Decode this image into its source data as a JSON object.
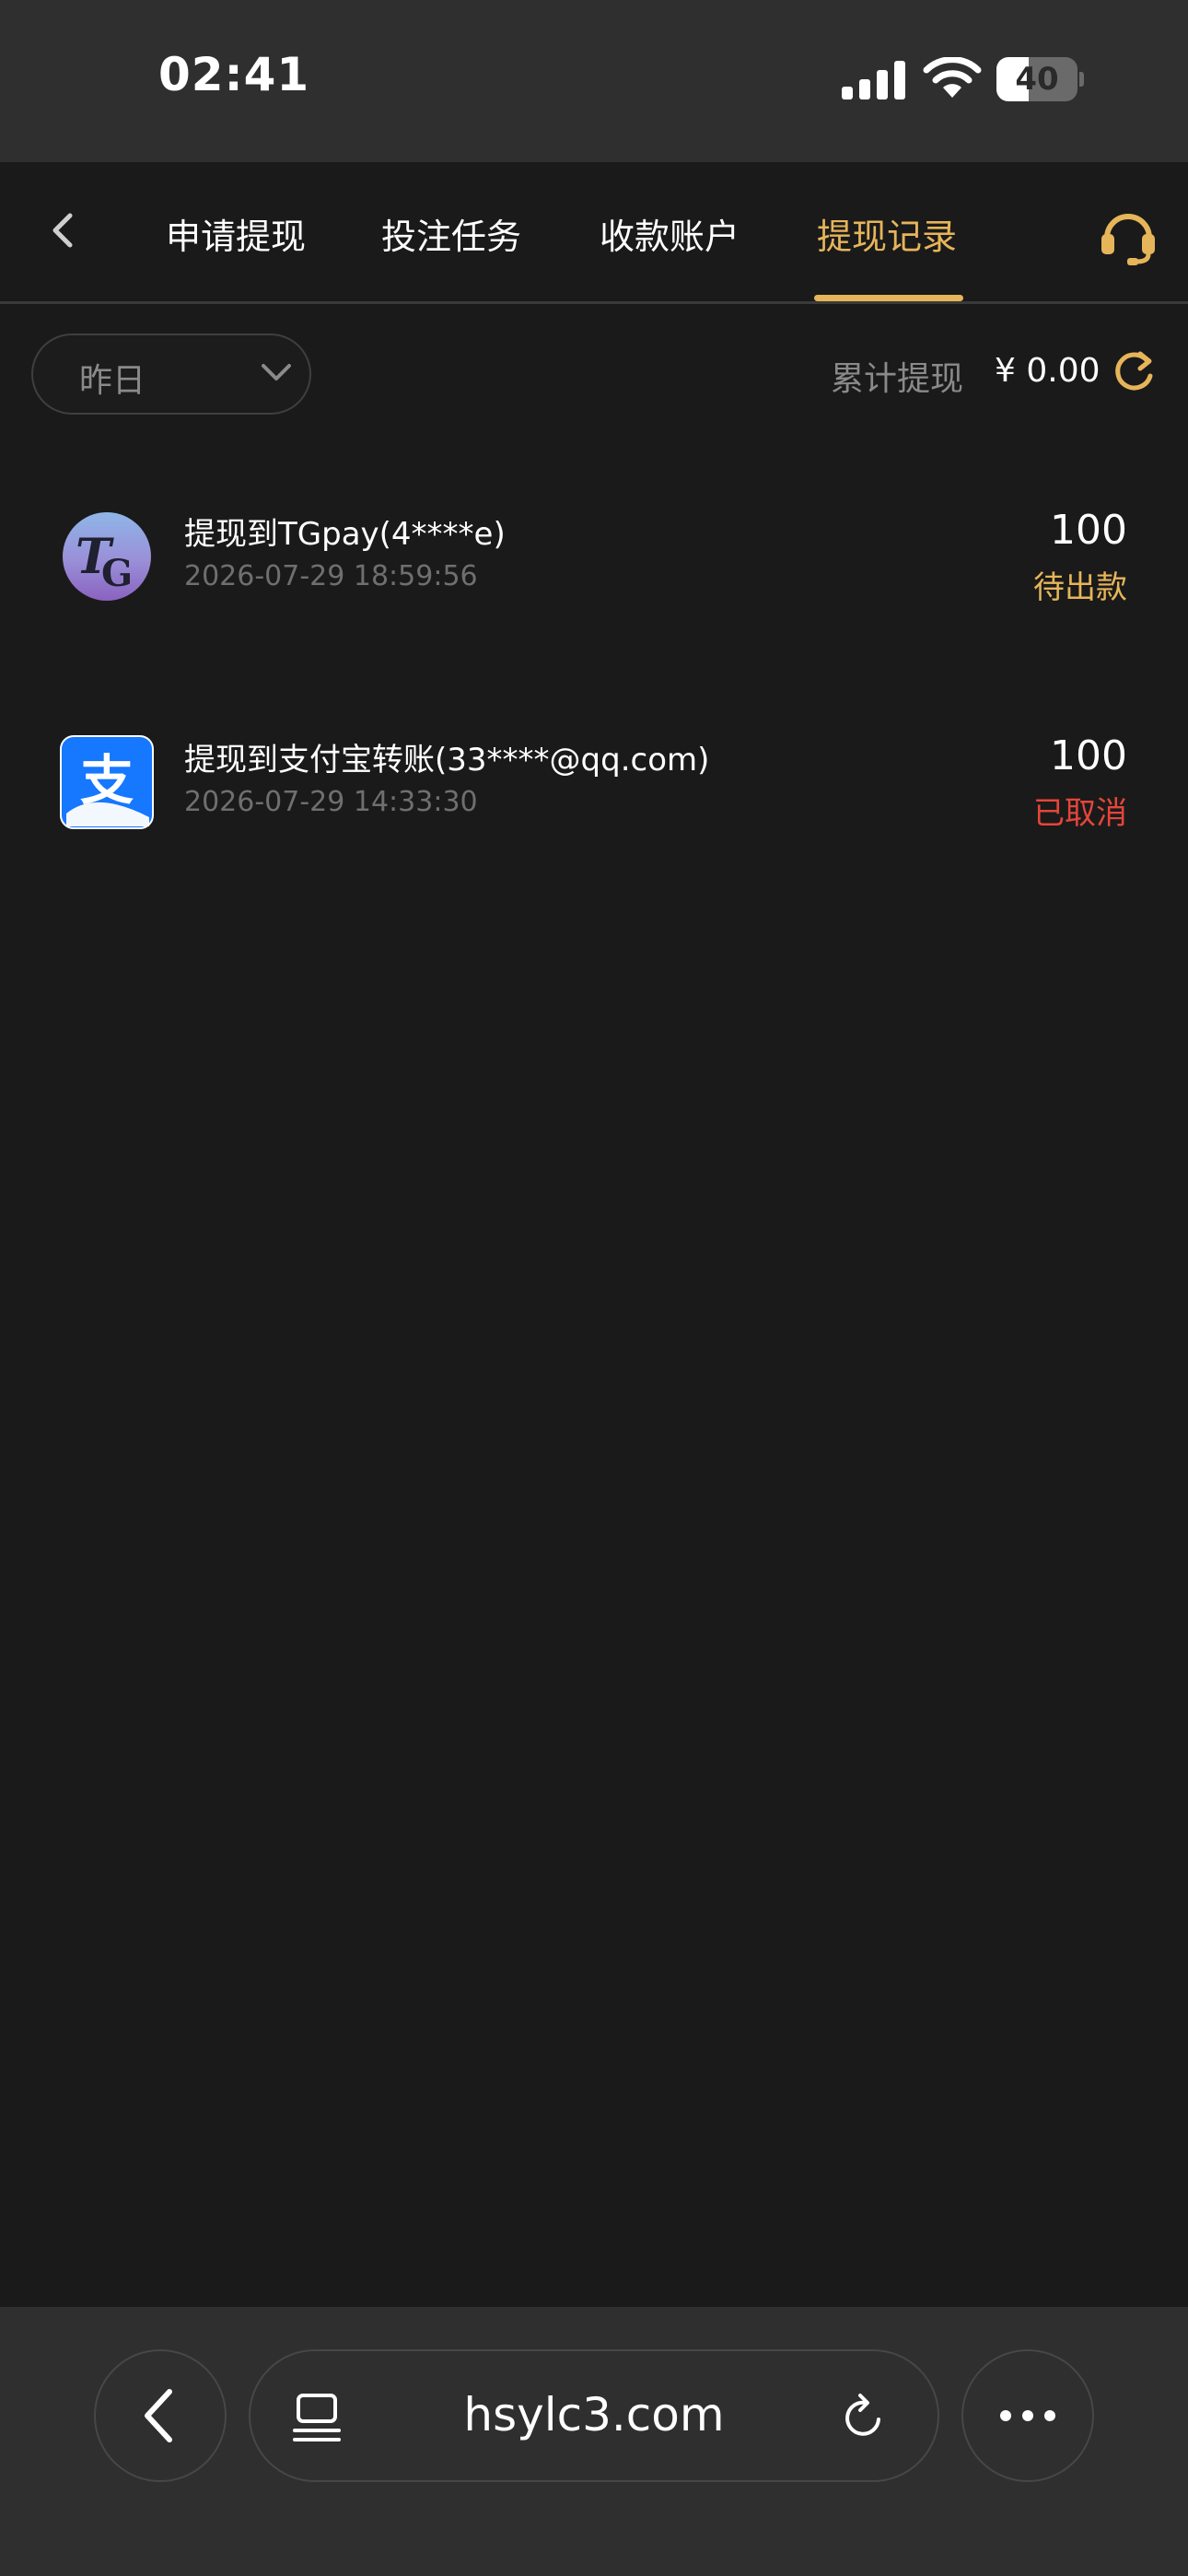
{
  "status_bar": {
    "time": "02:41",
    "battery_level": "40",
    "battery_fraction": 0.4
  },
  "nav": {
    "tabs": [
      {
        "label": "申请提现",
        "active": false
      },
      {
        "label": "投注任务",
        "active": false
      },
      {
        "label": "收款账户",
        "active": false
      },
      {
        "label": "提现记录",
        "active": true
      }
    ],
    "accent_color": "#e6b55a",
    "back_icon": "chevron-left-icon",
    "support_icon": "headset-icon"
  },
  "filter": {
    "selected": "昨日",
    "total_label": "累计提现",
    "total_amount": "¥ 0.00"
  },
  "records": [
    {
      "title": "提现到TGpay(4****e)",
      "time": "2026-07-29 18:59:56",
      "amount": "100",
      "status": "待出款",
      "status_color": "#e6b55a",
      "icon": "tgpay-logo-icon",
      "logo_text": "TG"
    },
    {
      "title": "提现到支付宝转账(33****@qq.com)",
      "time": "2026-07-29 14:33:30",
      "amount": "100",
      "status": "已取消",
      "status_color": "#e5453a",
      "icon": "alipay-logo-icon",
      "logo_text": "支"
    }
  ],
  "browser": {
    "url": "hsylc3.com"
  }
}
